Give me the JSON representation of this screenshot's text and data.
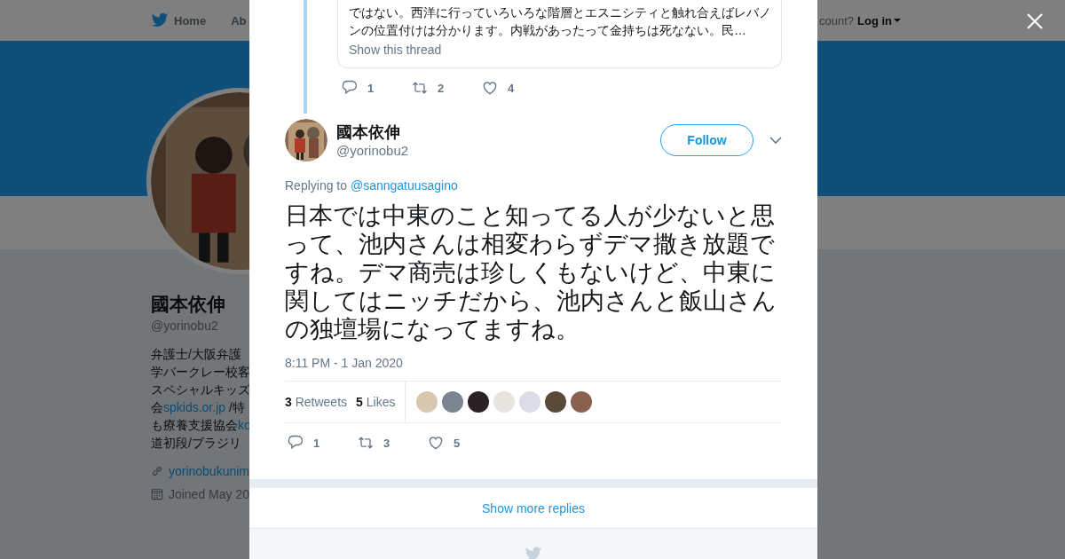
{
  "nav": {
    "items": [
      {
        "label": "Home"
      },
      {
        "label": "Ab"
      }
    ],
    "account_prompt": "count?",
    "login": "Log in"
  },
  "profile": {
    "name": "國本依伸",
    "handle": "@yorinobu2",
    "bio": [
      [
        {
          "text": "弁護士/大阪弁護"
        }
      ],
      [
        {
          "text": "学バークレー校客"
        }
      ],
      [
        {
          "text": "スペシャルキッズ"
        }
      ],
      [
        {
          "text": "会"
        },
        {
          "text": "spkids.or.jp",
          "kind": "link"
        },
        {
          "text": " /特"
        }
      ],
      [
        {
          "text": "も療養支援協会"
        },
        {
          "text": "ko",
          "kind": "link"
        }
      ],
      [
        {
          "text": "道初段/ブラジリ"
        }
      ]
    ],
    "website": "yorinobukunim",
    "joined": "Joined May 20"
  },
  "quoted": {
    "lines": [
      "ではない。西洋に行っていろいろな階層とエスニシティと触れ合えばレバノ",
      "ンの位置付けは分かります。内戦があったって金持ちは死なない。民…"
    ],
    "show_thread": "Show this thread",
    "actions": {
      "replies": "1",
      "retweets": "2",
      "likes": "4"
    }
  },
  "tweet": {
    "name": "國本依伸",
    "handle": "@yorinobu2",
    "follow": "Follow",
    "replying_prefix": "Replying to",
    "replying_to": "@sanngatuusagino",
    "text": "日本では中東のこと知ってる人が少ないと思って、池内さんは相変わらずデマ撒き放題ですね。デマ商売は珍しくもないけど、中東に関してはニッチだから、池内さんと飯山さんの独壇場になってますね。",
    "timestamp": "8:11 PM - 1 Jan 2020",
    "retweets_count": "3",
    "retweets_label": "Retweets",
    "likes_count": "5",
    "likes_label": "Likes",
    "likers": [
      {
        "color": "#d8c8b0"
      },
      {
        "color": "#7a8590"
      },
      {
        "color": "#2a2224"
      },
      {
        "color": "#e8e4e0"
      },
      {
        "color": "#dcdce6"
      },
      {
        "color": "#5a4a3a"
      },
      {
        "color": "#8a6050"
      }
    ],
    "actions": {
      "replies": "1",
      "retweets": "3",
      "likes": "5"
    }
  },
  "show_more": "Show more replies"
}
